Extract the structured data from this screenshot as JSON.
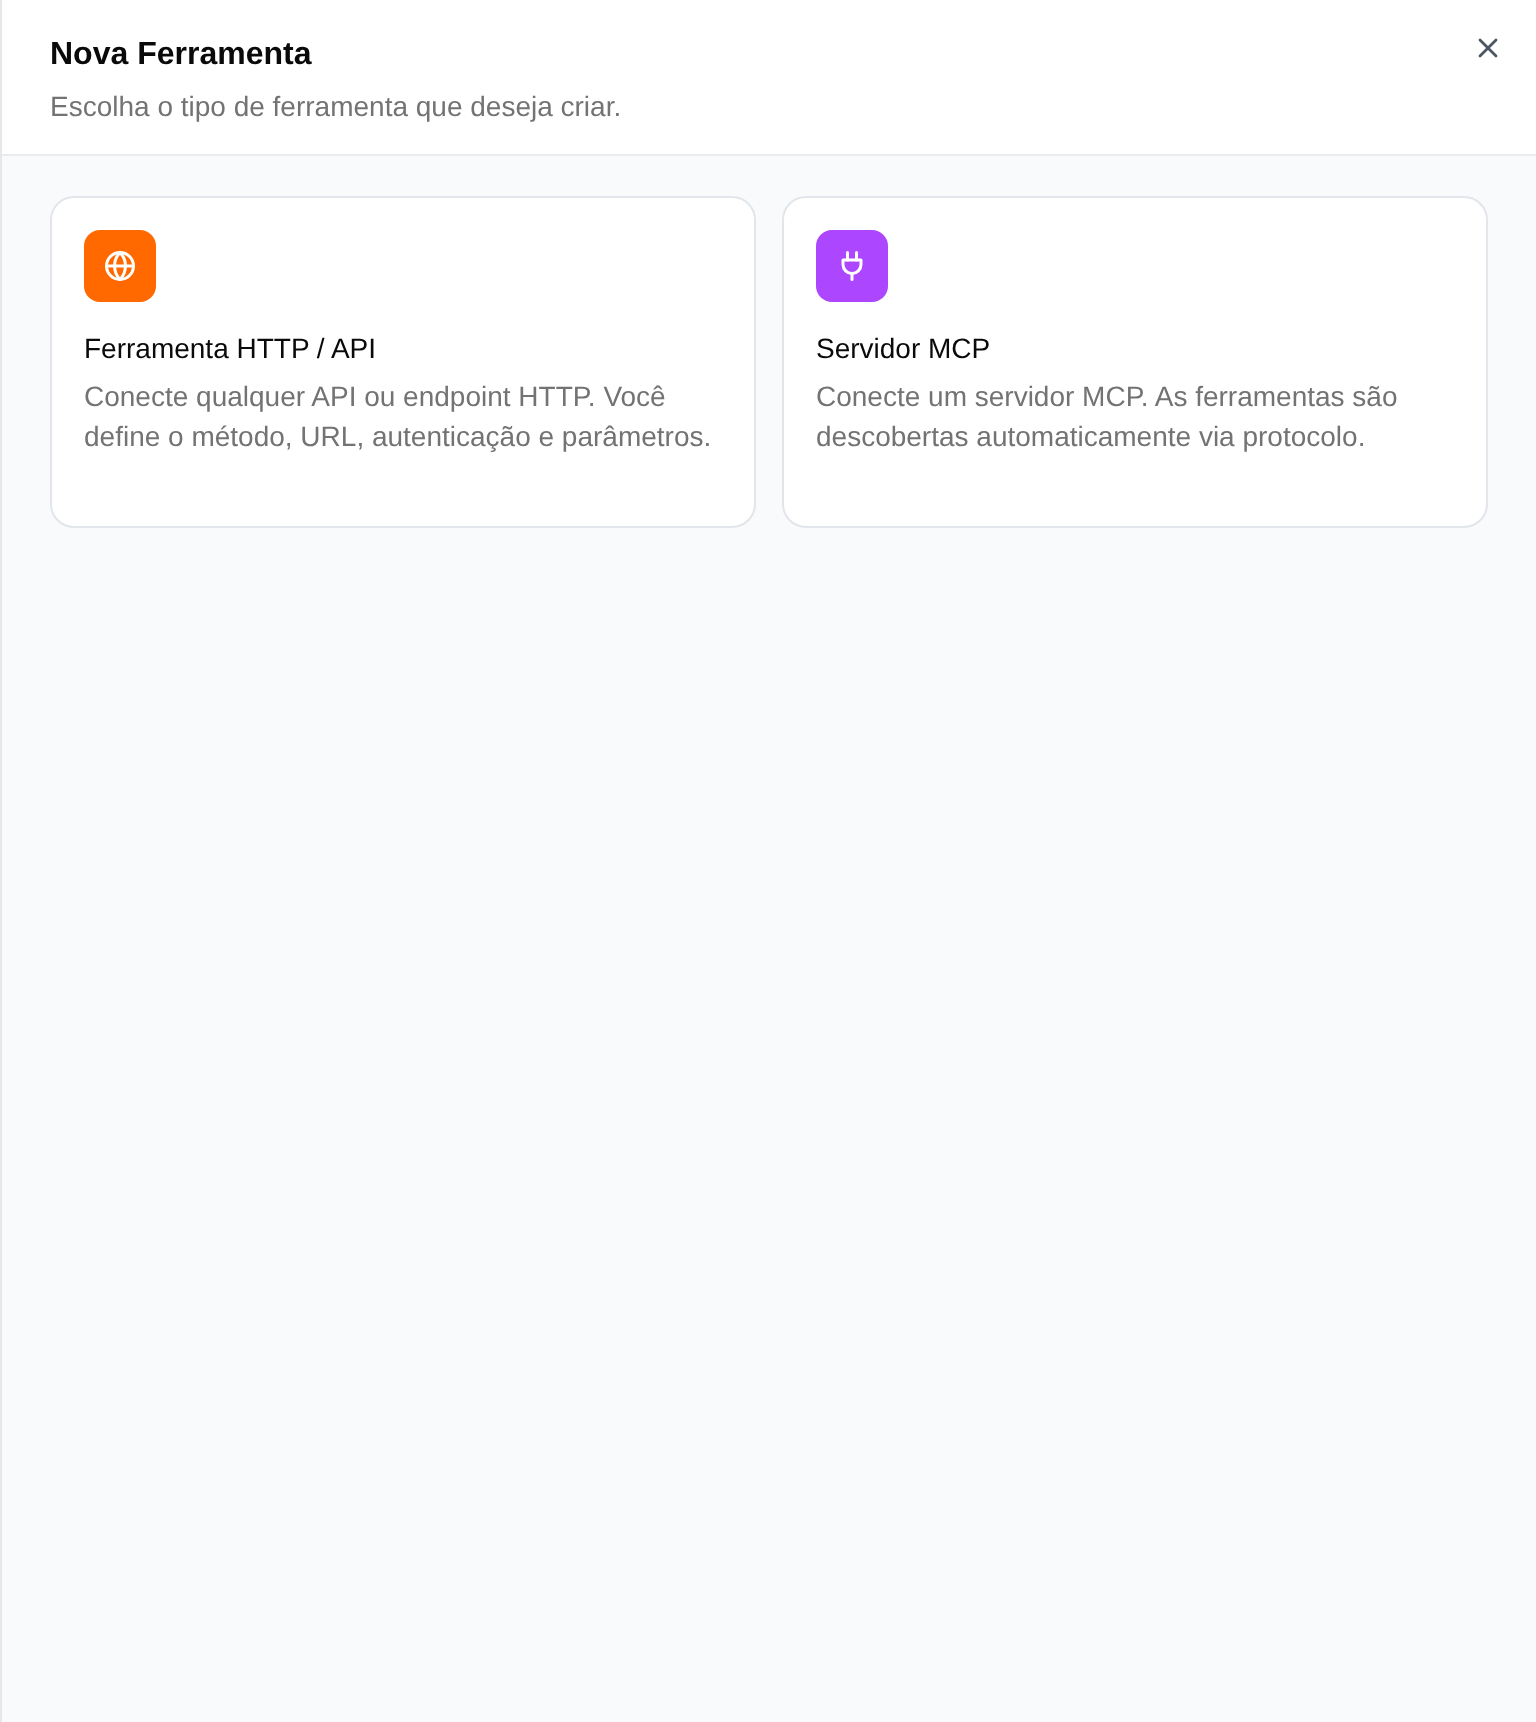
{
  "header": {
    "title": "Nova Ferramenta",
    "subtitle": "Escolha o tipo de ferramenta que deseja criar."
  },
  "tool_types": [
    {
      "title": "Ferramenta HTTP / API",
      "description": "Conecte qualquer API ou endpoint HTTP. Você define o método, URL, autenticação e parâmetros.",
      "color": "#ff6900"
    },
    {
      "title": "Servidor MCP",
      "description": "Conecte um servidor MCP. As ferramentas são descobertas automaticamente via protocolo.",
      "color": "#ad46ff"
    }
  ]
}
